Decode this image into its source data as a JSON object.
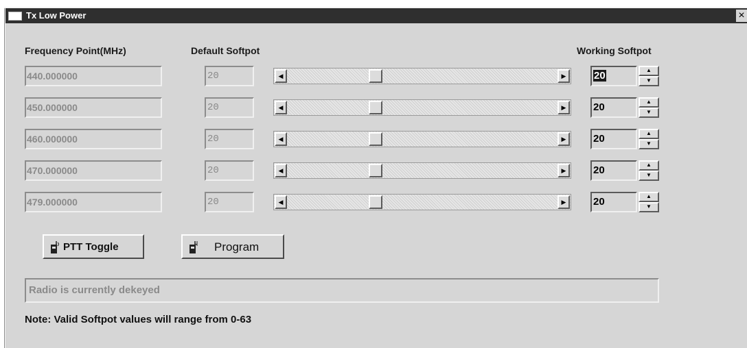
{
  "window": {
    "title": "Tx Low Power",
    "close_symbol": "×"
  },
  "headers": {
    "frequency": "Frequency Point(MHz)",
    "default": "Default Softpot",
    "working": "Working Softpot"
  },
  "rows": [
    {
      "frequency": "440.000000",
      "default": "20",
      "working": "20",
      "slider_value": 20
    },
    {
      "frequency": "450.000000",
      "default": "20",
      "working": "20",
      "slider_value": 20
    },
    {
      "frequency": "460.000000",
      "default": "20",
      "working": "20",
      "slider_value": 20
    },
    {
      "frequency": "470.000000",
      "default": "20",
      "working": "20",
      "slider_value": 20
    },
    {
      "frequency": "479.000000",
      "default": "20",
      "working": "20",
      "slider_value": 20
    }
  ],
  "slider_range": [
    0,
    63
  ],
  "buttons": {
    "ptt": "PTT Toggle",
    "program": "Program"
  },
  "status_text": "Radio is currently dekeyed",
  "note": "Note: Valid Softpot values will range from 0-63",
  "icons": {
    "system": "window-icon",
    "close": "close-icon",
    "ptt": "radio-icon",
    "program": "radio-program-icon",
    "scroll_left": "arrow-left-icon",
    "scroll_right": "arrow-right-icon",
    "spin_up": "arrow-up-icon",
    "spin_down": "arrow-down-icon"
  },
  "colors": {
    "titlebar": "#2f2f2f",
    "window": "#d6d6d6",
    "disabled_text": "#8a8a8a"
  }
}
